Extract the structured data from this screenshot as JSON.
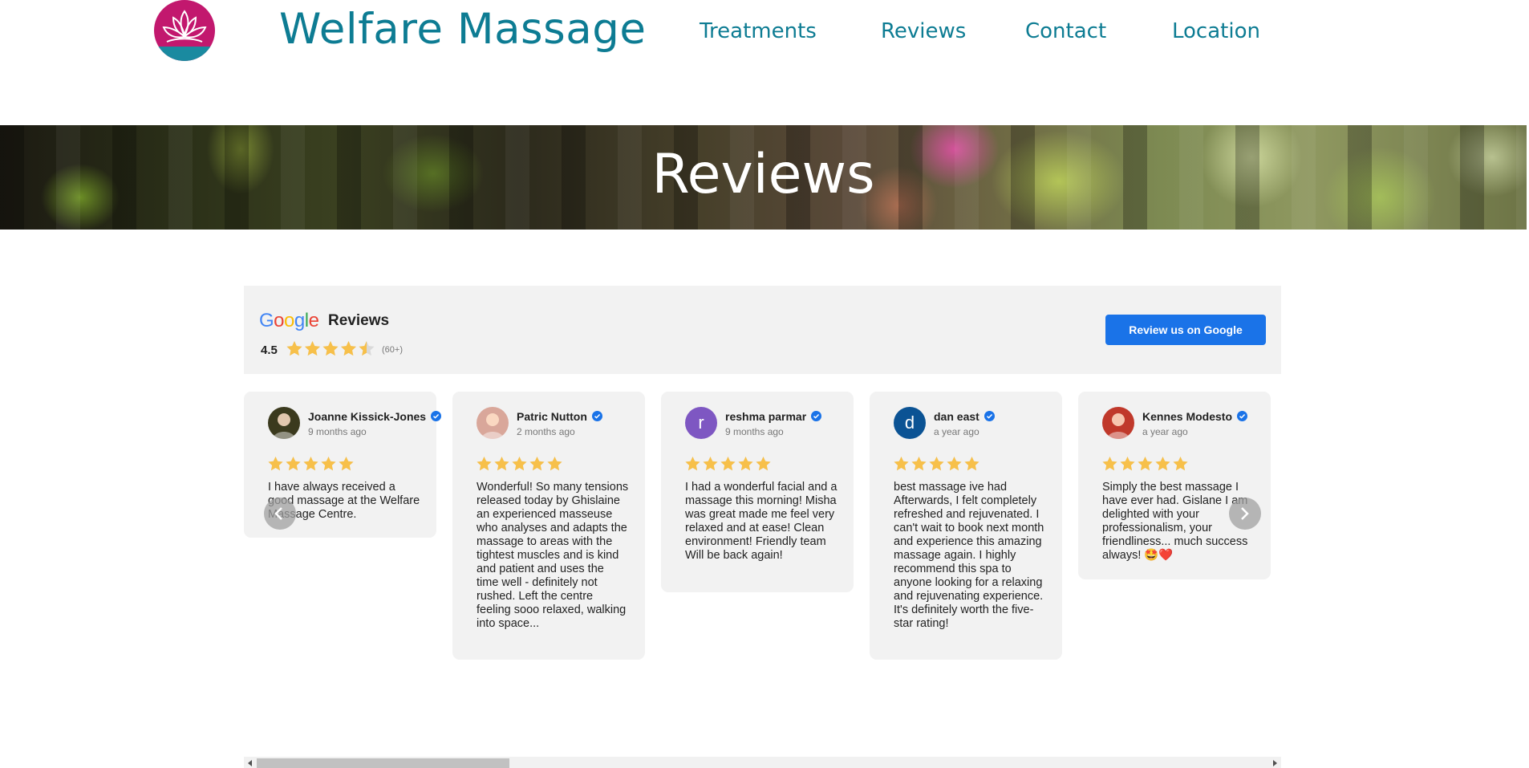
{
  "header": {
    "brand": "Welfare Massage",
    "nav": [
      "Treatments",
      "Reviews",
      "Contact",
      "Location"
    ]
  },
  "hero": {
    "title": "Reviews"
  },
  "widget": {
    "logo_letters": [
      "G",
      "o",
      "o",
      "g",
      "l",
      "e"
    ],
    "logo_colors": [
      "#4285F4",
      "#EA4335",
      "#FBBC05",
      "#4285F4",
      "#34A853",
      "#EA4335"
    ],
    "title": "Reviews",
    "rating": "4.5",
    "rating_value": 4.5,
    "count": "(60+)",
    "button": "Review us on Google",
    "star_color": "#f7c04a"
  },
  "reviews": [
    {
      "name": "Joanne Kissick-Jones",
      "time": "9 months ago",
      "stars": 5,
      "text": "I have always received a good massage at the Welfare Massage Centre.",
      "avatar_type": "photo",
      "avatar_color": "#3b3a1e"
    },
    {
      "name": "Patric Nutton",
      "time": "2 months ago",
      "stars": 5,
      "text": "Wonderful! So many tensions released today by Ghislaine an experienced masseuse who analyses and adapts the massage to areas with the tightest muscles and is kind and patient and uses the time well - definitely not rushed. Left the centre feeling sooo relaxed, walking into space...",
      "avatar_type": "photo",
      "avatar_color": "#d9a79a"
    },
    {
      "name": "reshma parmar",
      "time": "9 months ago",
      "stars": 5,
      "text": "I had a wonderful facial and a massage this morning! Misha was great made me feel very relaxed and at ease! Clean environment! Friendly team Will be back again!",
      "avatar_type": "letter",
      "avatar_letter": "r",
      "avatar_color": "#7e57c2"
    },
    {
      "name": "dan east",
      "time": "a year ago",
      "stars": 5,
      "text": "best massage ive had Afterwards, I felt completely refreshed and rejuvenated. I can't wait to book next month and experience this amazing massage again. I highly recommend this spa to anyone looking for a relaxing and rejuvenating experience. It's definitely worth the five-star rating!",
      "avatar_type": "letter",
      "avatar_letter": "d",
      "avatar_color": "#0b5394"
    },
    {
      "name": "Kennes Modesto",
      "time": "a year ago",
      "stars": 5,
      "text": "Simply the best massage I have ever had. Gislane I am delighted with your professionalism, your friendliness... much success always! 🤩❤️",
      "avatar_type": "photo",
      "avatar_color": "#c0392b"
    }
  ],
  "scrollbar": {
    "thumb_fraction": 0.25
  }
}
